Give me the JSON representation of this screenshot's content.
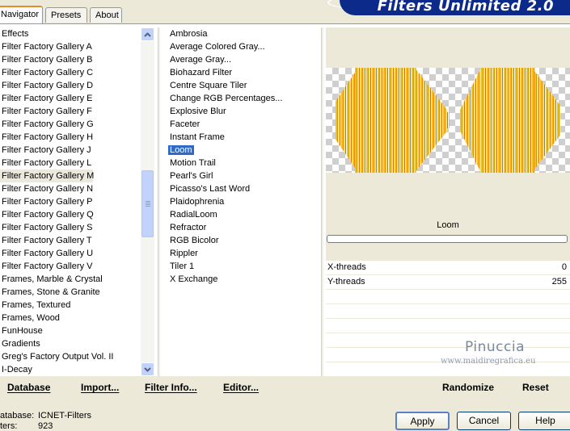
{
  "tabs": [
    "Navigator",
    "Presets",
    "About"
  ],
  "banner_title": "Filters Unlimited 2.0",
  "categories": [
    "Effects",
    "Filter Factory Gallery A",
    "Filter Factory Gallery B",
    "Filter Factory Gallery C",
    "Filter Factory Gallery D",
    "Filter Factory Gallery E",
    "Filter Factory Gallery F",
    "Filter Factory Gallery G",
    "Filter Factory Gallery H",
    "Filter Factory Gallery J",
    "Filter Factory Gallery L",
    "Filter Factory Gallery M",
    "Filter Factory Gallery N",
    "Filter Factory Gallery P",
    "Filter Factory Gallery Q",
    "Filter Factory Gallery S",
    "Filter Factory Gallery T",
    "Filter Factory Gallery U",
    "Filter Factory Gallery V",
    "Frames, Marble & Crystal",
    "Frames, Stone & Granite",
    "Frames, Textured",
    "Frames, Wood",
    "FunHouse",
    "Gradients",
    "Greg's Factory Output Vol. II",
    "I-Decay"
  ],
  "selected_category": "Filter Factory Gallery M",
  "filters": [
    "Ambrosia",
    "Average Colored Gray...",
    "Average Gray...",
    "Biohazard Filter",
    "Centre Square Tiler",
    "Change RGB Percentages...",
    "Explosive Blur",
    "Faceter",
    "Instant Frame",
    "Loom",
    "Motion Trail",
    "Pearl's Girl",
    "Picasso's Last Word",
    "Plaidophrenia",
    "RadialLoom",
    "Refractor",
    "RGB Bicolor",
    "Rippler",
    "Tiler 1",
    "X Exchange"
  ],
  "selected_filter": "Loom",
  "filter_name": "Loom",
  "params": [
    {
      "label": "X-threads",
      "value": "0"
    },
    {
      "label": "Y-threads",
      "value": "255"
    }
  ],
  "watermark": {
    "name": "Pinuccia",
    "url": "www.maidiregrafica.eu"
  },
  "bottom_links": {
    "database": "Database",
    "import": "Import...",
    "filter_info": "Filter Info...",
    "editor": "Editor...",
    "randomize": "Randomize",
    "reset": "Reset"
  },
  "status": {
    "database_label": "atabase:",
    "database_value": "ICNET-Filters",
    "filters_label": "ters:",
    "filters_value": "923"
  },
  "buttons": {
    "apply": "Apply",
    "cancel": "Cancel",
    "help": "Help"
  },
  "colors": {
    "banner": "#0b2a8a",
    "selection": "#316ac5",
    "accent_tab": "#e68b2c"
  }
}
